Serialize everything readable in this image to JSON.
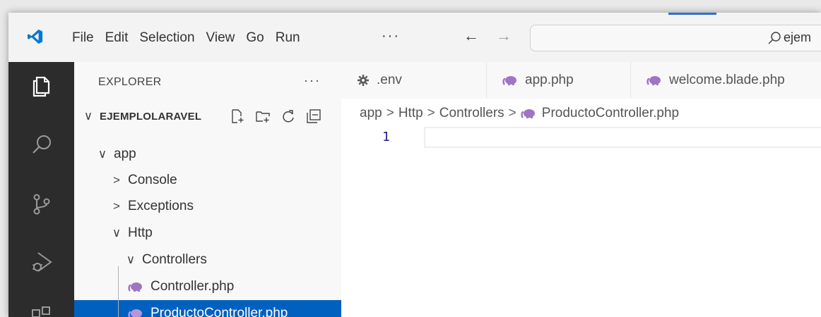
{
  "menu": {
    "items": [
      "File",
      "Edit",
      "Selection",
      "View",
      "Go",
      "Run"
    ],
    "more": "···"
  },
  "command_center": {
    "text": "ejem"
  },
  "explorer": {
    "title": "EXPLORER",
    "more": "···",
    "root": "EJEMPLOLARAVEL",
    "tree": [
      {
        "label": "app",
        "chevron": "∨"
      },
      {
        "label": "Console",
        "chevron": ">"
      },
      {
        "label": "Exceptions",
        "chevron": ">"
      },
      {
        "label": "Http",
        "chevron": "∨"
      },
      {
        "label": "Controllers",
        "chevron": "∨"
      },
      {
        "label": "Controller.php"
      },
      {
        "label": "ProductoController.php",
        "selected": true
      }
    ]
  },
  "tabs": [
    {
      "label": ".env",
      "icon": "gear-icon"
    },
    {
      "label": "app.php",
      "icon": "php-elephant-icon"
    },
    {
      "label": "welcome.blade.php",
      "icon": "php-elephant-icon"
    }
  ],
  "breadcrumb": {
    "parts": [
      "app",
      "Http",
      "Controllers"
    ],
    "file": "ProductoController.php",
    "separator": ">"
  },
  "editor": {
    "line_number": "1"
  },
  "colors": {
    "selection": "#0060c0",
    "activity_bar": "#2c2c2c",
    "php_icon": "#a074c4",
    "vscode_blue": "#0078d4"
  }
}
